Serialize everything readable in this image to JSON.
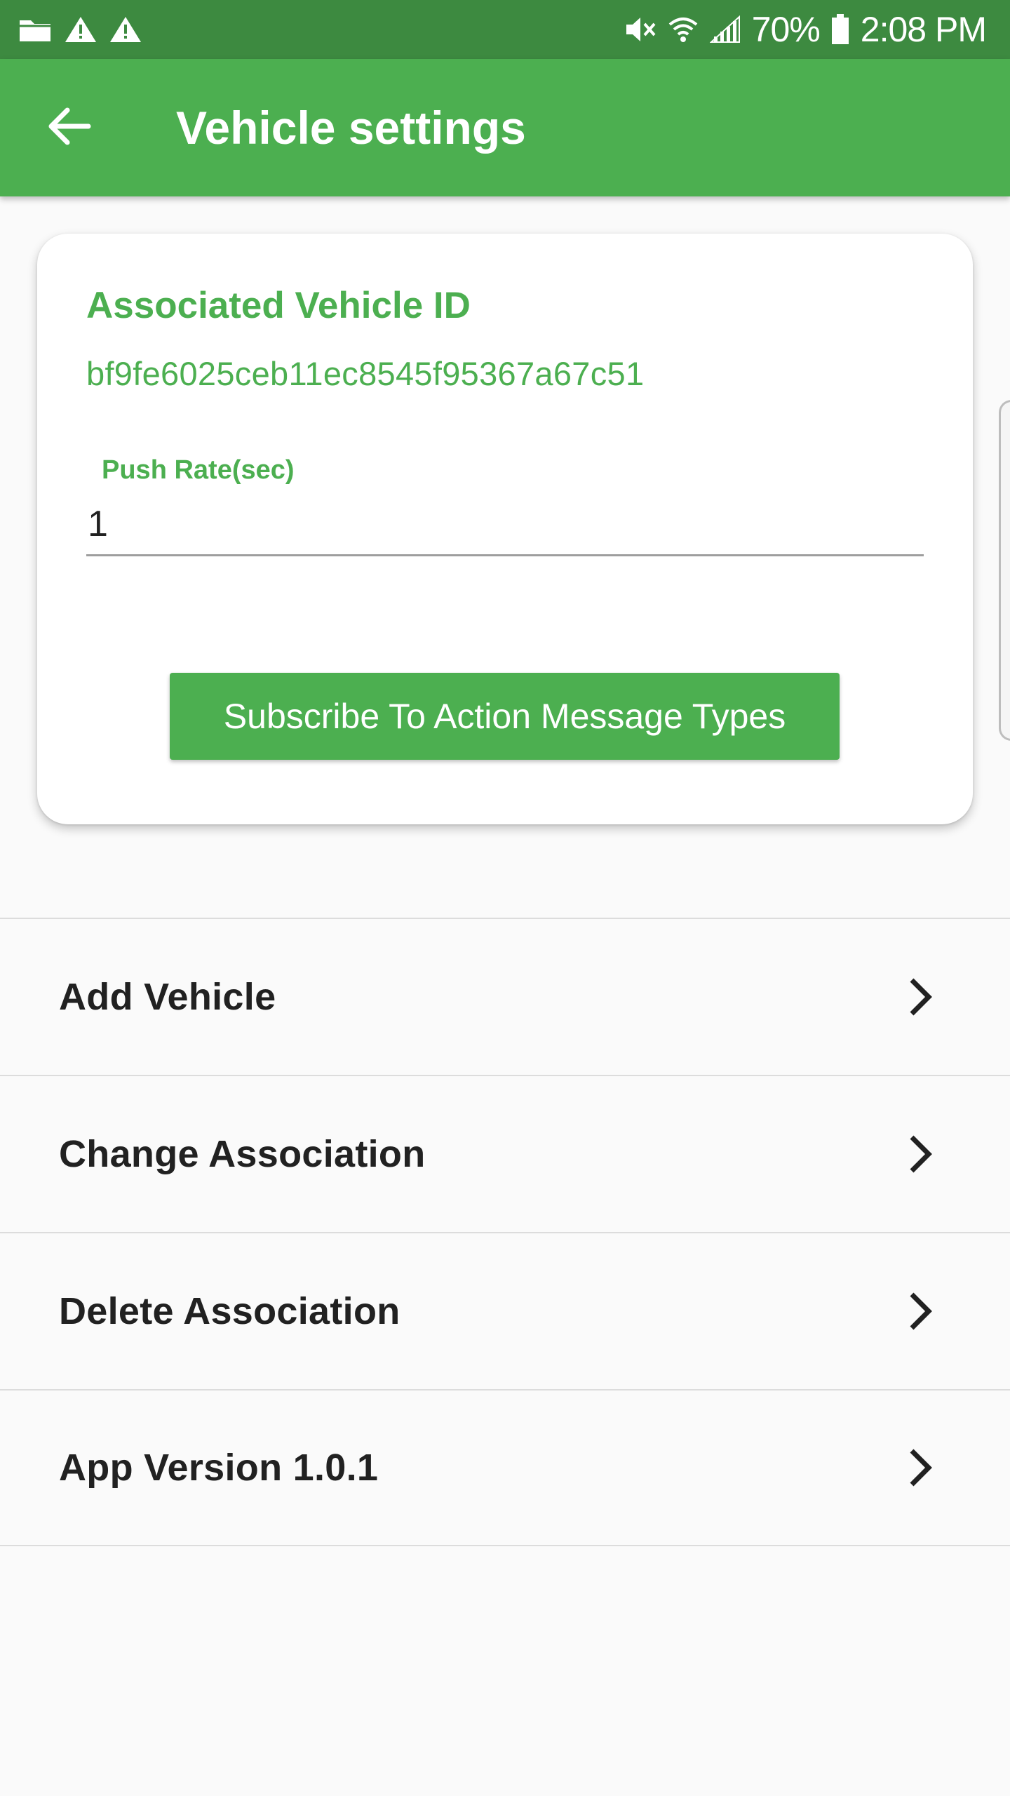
{
  "status_bar": {
    "left_icons": [
      "folder-icon",
      "warning-icon",
      "warning-icon"
    ],
    "right_icons": [
      "mute-icon",
      "wifi-icon",
      "signal-icon",
      "battery-icon"
    ],
    "battery": "70%",
    "time": "2:08 PM"
  },
  "app_bar": {
    "title": "Vehicle settings",
    "back_icon": "arrow-left-icon",
    "color": "#4caf50"
  },
  "card": {
    "heading": "Associated Vehicle ID",
    "vehicle_id": "bf9fe6025ceb11ec8545f95367a67c51",
    "push_rate": {
      "label": "Push Rate(sec)",
      "value": "1"
    },
    "subscribe_label": "Subscribe To Action Message Types"
  },
  "menu": {
    "items": [
      {
        "label": "Add Vehicle",
        "icon": "chevron-right-icon"
      },
      {
        "label": "Change Association",
        "icon": "chevron-right-icon"
      },
      {
        "label": "Delete Association",
        "icon": "chevron-right-icon"
      },
      {
        "label": "App Version 1.0.1",
        "icon": "chevron-right-icon"
      }
    ]
  },
  "colors": {
    "accent": "#4caf50",
    "status_bar": "#3d8a40",
    "background": "#fafafa"
  }
}
